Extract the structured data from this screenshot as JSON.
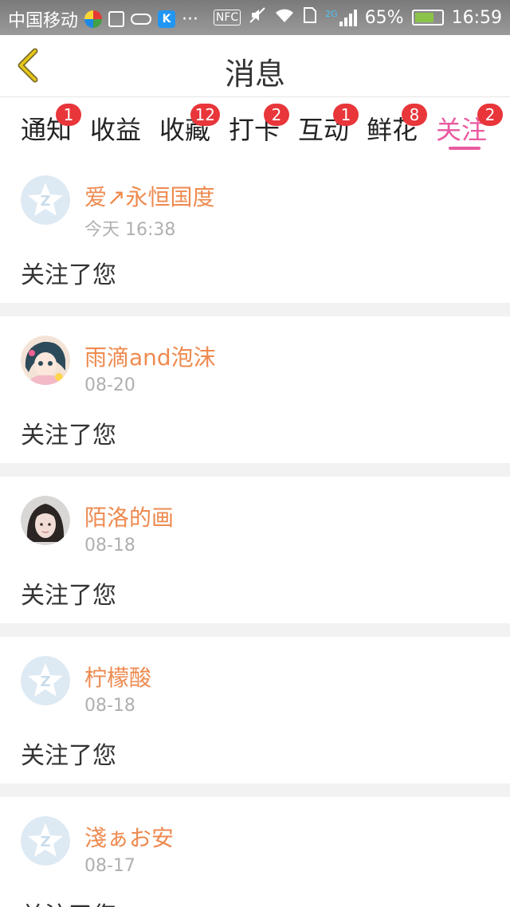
{
  "status_bar": {
    "carrier": "中国移动",
    "more": "···",
    "nfc": "NFC",
    "network": "2G",
    "battery": "65%",
    "time": "16:59"
  },
  "header": {
    "title": "消息"
  },
  "tabs": [
    {
      "label": "通知",
      "badge": "1"
    },
    {
      "label": "收益",
      "badge": ""
    },
    {
      "label": "收藏",
      "badge": "12"
    },
    {
      "label": "打卡",
      "badge": "2"
    },
    {
      "label": "互动",
      "badge": "1"
    },
    {
      "label": "鲜花",
      "badge": "8"
    },
    {
      "label": "关注",
      "badge": "2",
      "active": true
    }
  ],
  "messages": [
    {
      "name": "爱↗永恒国度",
      "time": "今天 16:38",
      "text": "关注了您",
      "avatar": "default-star"
    },
    {
      "name": "雨滴and泡沫",
      "time": "08-20",
      "text": "关注了您",
      "avatar": "anime-girl"
    },
    {
      "name": "陌洛的画",
      "time": "08-18",
      "text": "关注了您",
      "avatar": "photo-girl"
    },
    {
      "name": "柠檬酸",
      "time": "08-18",
      "text": "关注了您",
      "avatar": "default-star"
    },
    {
      "name": "淺ぁお安",
      "time": "08-17",
      "text": "关注了您",
      "avatar": "default-star"
    }
  ],
  "colors": {
    "accent": "#e95a9f",
    "name": "#ee8a4f",
    "badge": "#e8363a",
    "back_icon": "#d4b400"
  }
}
